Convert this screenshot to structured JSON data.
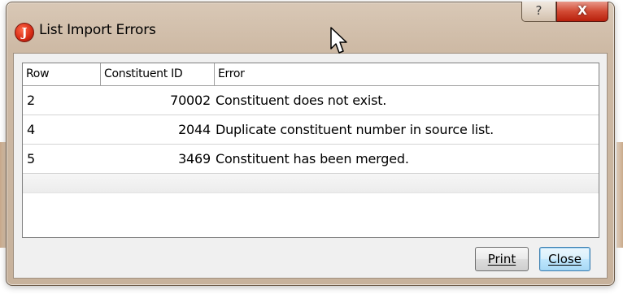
{
  "window": {
    "title": "List Import Errors",
    "app_icon_glyph": "J",
    "help_glyph": "?",
    "close_glyph": "X"
  },
  "grid": {
    "columns": [
      "Row",
      "Constituent ID",
      "Error"
    ],
    "rows": [
      {
        "row": "2",
        "constituent_id": "70002",
        "error": "Constituent does not exist."
      },
      {
        "row": "4",
        "constituent_id": "2044",
        "error": "Duplicate constituent number in source list."
      },
      {
        "row": "5",
        "constituent_id": "3469",
        "error": "Constituent has been merged."
      }
    ]
  },
  "buttons": {
    "print_label": "Print",
    "close_label": "Close"
  },
  "colors": {
    "title_bar": "#d9c8b6",
    "close_button": "#d24a34",
    "default_button": "#bee6fd",
    "app_icon": "#d62a14"
  },
  "icons": {
    "app": "app-logo-icon",
    "help": "help-icon",
    "close": "close-icon",
    "pointer": "mouse-cursor-icon"
  }
}
